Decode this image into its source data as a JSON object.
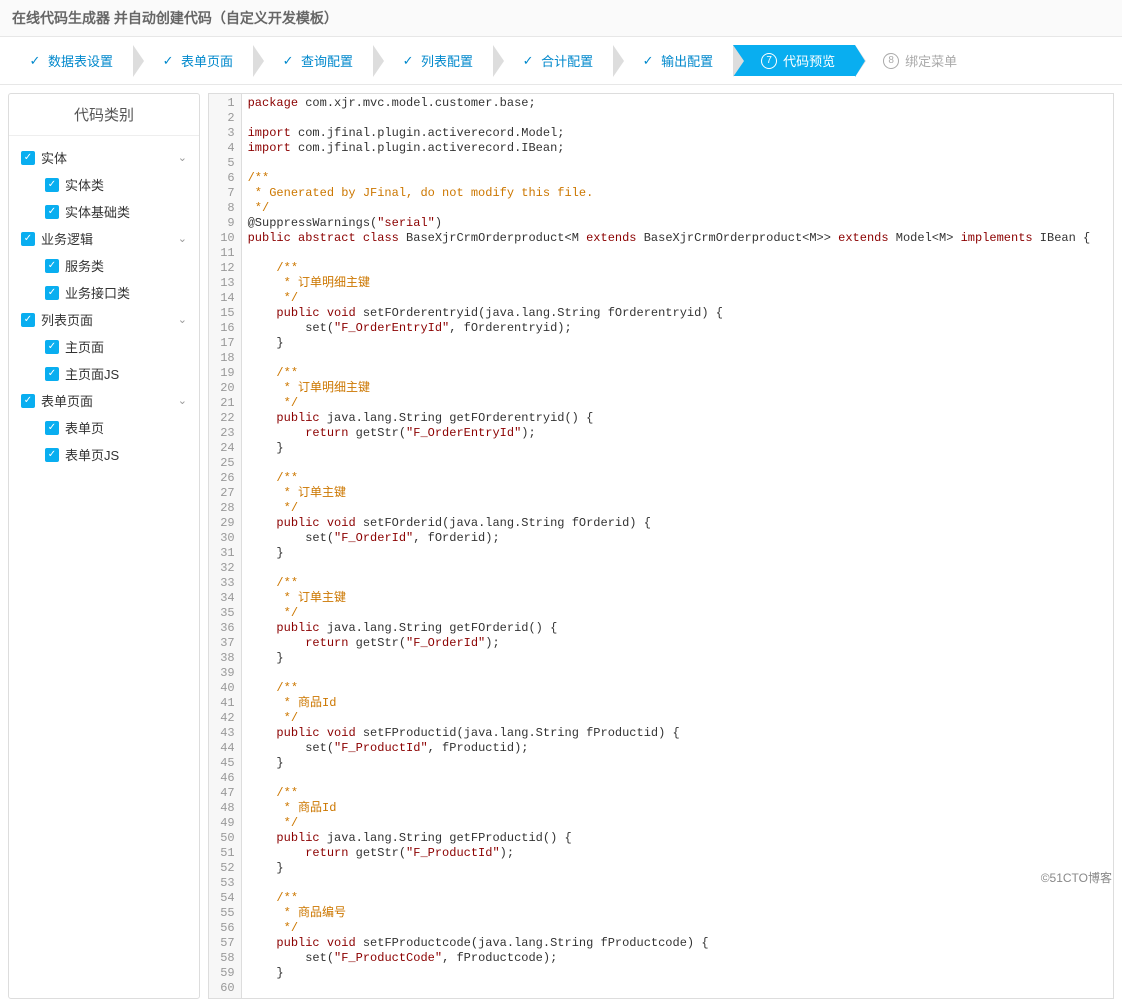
{
  "header": {
    "title": "在线代码生成器 并自动创建代码（自定义开发模板）"
  },
  "steps": [
    {
      "label": "数据表设置",
      "icon": "check",
      "state": "normal"
    },
    {
      "label": "表单页面",
      "icon": "check",
      "state": "normal"
    },
    {
      "label": "查询配置",
      "icon": "check",
      "state": "normal"
    },
    {
      "label": "列表配置",
      "icon": "check",
      "state": "normal"
    },
    {
      "label": "合计配置",
      "icon": "check",
      "state": "normal"
    },
    {
      "label": "输出配置",
      "icon": "check",
      "state": "normal"
    },
    {
      "label": "代码预览",
      "icon": "num7",
      "state": "active"
    },
    {
      "label": "绑定菜单",
      "icon": "num8",
      "state": "disabled"
    }
  ],
  "sidebar": {
    "title": "代码类别",
    "tree": [
      {
        "label": "实体",
        "checked": true,
        "level": 0,
        "expandable": true
      },
      {
        "label": "实体类",
        "checked": true,
        "level": 1
      },
      {
        "label": "实体基础类",
        "checked": true,
        "level": 1
      },
      {
        "label": "业务逻辑",
        "checked": true,
        "level": 0,
        "expandable": true
      },
      {
        "label": "服务类",
        "checked": true,
        "level": 1
      },
      {
        "label": "业务接口类",
        "checked": true,
        "level": 1
      },
      {
        "label": "列表页面",
        "checked": true,
        "level": 0,
        "expandable": true
      },
      {
        "label": "主页面",
        "checked": true,
        "level": 1
      },
      {
        "label": "主页面JS",
        "checked": true,
        "level": 1
      },
      {
        "label": "表单页面",
        "checked": true,
        "level": 0,
        "expandable": true
      },
      {
        "label": "表单页",
        "checked": true,
        "level": 1
      },
      {
        "label": "表单页JS",
        "checked": true,
        "level": 1
      }
    ]
  },
  "code": {
    "lines": [
      {
        "t": [
          {
            "c": "",
            "s": ""
          },
          {
            "c": "package",
            "s": "kw"
          },
          {
            "c": " com.xjr.mvc.model.customer.base;",
            "s": ""
          }
        ]
      },
      {
        "t": [
          {
            "c": "",
            "s": ""
          }
        ]
      },
      {
        "t": [
          {
            "c": "import",
            "s": "kw"
          },
          {
            "c": " com.jfinal.plugin.activerecord.Model;",
            "s": ""
          }
        ]
      },
      {
        "t": [
          {
            "c": "import",
            "s": "kw"
          },
          {
            "c": " com.jfinal.plugin.activerecord.IBean;",
            "s": ""
          }
        ]
      },
      {
        "t": [
          {
            "c": "",
            "s": ""
          }
        ]
      },
      {
        "t": [
          {
            "c": "/**",
            "s": "cmt"
          }
        ]
      },
      {
        "t": [
          {
            "c": " * Generated by JFinal, do not modify this file.",
            "s": "cmt"
          }
        ]
      },
      {
        "t": [
          {
            "c": " */",
            "s": "cmt"
          }
        ]
      },
      {
        "t": [
          {
            "c": "@SuppressWarnings(",
            "s": ""
          },
          {
            "c": "\"serial\"",
            "s": "str"
          },
          {
            "c": ")",
            "s": ""
          }
        ]
      },
      {
        "t": [
          {
            "c": "public",
            "s": "kw"
          },
          {
            "c": " ",
            "s": ""
          },
          {
            "c": "abstract",
            "s": "kw"
          },
          {
            "c": " ",
            "s": ""
          },
          {
            "c": "class",
            "s": "kw"
          },
          {
            "c": " BaseXjrCrmOrderproduct<M ",
            "s": ""
          },
          {
            "c": "extends",
            "s": "kw"
          },
          {
            "c": " BaseXjrCrmOrderproduct<M>> ",
            "s": ""
          },
          {
            "c": "extends",
            "s": "kw"
          },
          {
            "c": " Model<M> ",
            "s": ""
          },
          {
            "c": "implements",
            "s": "kw"
          },
          {
            "c": " IBean {",
            "s": ""
          }
        ]
      },
      {
        "t": [
          {
            "c": "",
            "s": ""
          }
        ]
      },
      {
        "t": [
          {
            "c": "    /**",
            "s": "cmt"
          }
        ]
      },
      {
        "t": [
          {
            "c": "     * 订单明细主键",
            "s": "cmt"
          }
        ]
      },
      {
        "t": [
          {
            "c": "     */",
            "s": "cmt"
          }
        ]
      },
      {
        "t": [
          {
            "c": "    ",
            "s": ""
          },
          {
            "c": "public",
            "s": "kw"
          },
          {
            "c": " ",
            "s": ""
          },
          {
            "c": "void",
            "s": "kw"
          },
          {
            "c": " setFOrderentryid(java.lang.String fOrderentryid) {",
            "s": ""
          }
        ]
      },
      {
        "t": [
          {
            "c": "        set(",
            "s": ""
          },
          {
            "c": "\"F_OrderEntryId\"",
            "s": "str"
          },
          {
            "c": ", fOrderentryid);",
            "s": ""
          }
        ]
      },
      {
        "t": [
          {
            "c": "    }",
            "s": ""
          }
        ]
      },
      {
        "t": [
          {
            "c": "",
            "s": ""
          }
        ]
      },
      {
        "t": [
          {
            "c": "    /**",
            "s": "cmt"
          }
        ]
      },
      {
        "t": [
          {
            "c": "     * 订单明细主键",
            "s": "cmt"
          }
        ]
      },
      {
        "t": [
          {
            "c": "     */",
            "s": "cmt"
          }
        ]
      },
      {
        "t": [
          {
            "c": "    ",
            "s": ""
          },
          {
            "c": "public",
            "s": "kw"
          },
          {
            "c": " java.lang.String getFOrderentryid() {",
            "s": ""
          }
        ]
      },
      {
        "t": [
          {
            "c": "        ",
            "s": ""
          },
          {
            "c": "return",
            "s": "kw"
          },
          {
            "c": " getStr(",
            "s": ""
          },
          {
            "c": "\"F_OrderEntryId\"",
            "s": "str"
          },
          {
            "c": ");",
            "s": ""
          }
        ]
      },
      {
        "t": [
          {
            "c": "    }",
            "s": ""
          }
        ]
      },
      {
        "t": [
          {
            "c": "",
            "s": ""
          }
        ]
      },
      {
        "t": [
          {
            "c": "    /**",
            "s": "cmt"
          }
        ]
      },
      {
        "t": [
          {
            "c": "     * 订单主键",
            "s": "cmt"
          }
        ]
      },
      {
        "t": [
          {
            "c": "     */",
            "s": "cmt"
          }
        ]
      },
      {
        "t": [
          {
            "c": "    ",
            "s": ""
          },
          {
            "c": "public",
            "s": "kw"
          },
          {
            "c": " ",
            "s": ""
          },
          {
            "c": "void",
            "s": "kw"
          },
          {
            "c": " setFOrderid(java.lang.String fOrderid) {",
            "s": ""
          }
        ]
      },
      {
        "t": [
          {
            "c": "        set(",
            "s": ""
          },
          {
            "c": "\"F_OrderId\"",
            "s": "str"
          },
          {
            "c": ", fOrderid);",
            "s": ""
          }
        ]
      },
      {
        "t": [
          {
            "c": "    }",
            "s": ""
          }
        ]
      },
      {
        "t": [
          {
            "c": "",
            "s": ""
          }
        ]
      },
      {
        "t": [
          {
            "c": "    /**",
            "s": "cmt"
          }
        ]
      },
      {
        "t": [
          {
            "c": "     * 订单主键",
            "s": "cmt"
          }
        ]
      },
      {
        "t": [
          {
            "c": "     */",
            "s": "cmt"
          }
        ]
      },
      {
        "t": [
          {
            "c": "    ",
            "s": ""
          },
          {
            "c": "public",
            "s": "kw"
          },
          {
            "c": " java.lang.String getFOrderid() {",
            "s": ""
          }
        ]
      },
      {
        "t": [
          {
            "c": "        ",
            "s": ""
          },
          {
            "c": "return",
            "s": "kw"
          },
          {
            "c": " getStr(",
            "s": ""
          },
          {
            "c": "\"F_OrderId\"",
            "s": "str"
          },
          {
            "c": ");",
            "s": ""
          }
        ]
      },
      {
        "t": [
          {
            "c": "    }",
            "s": ""
          }
        ]
      },
      {
        "t": [
          {
            "c": "",
            "s": ""
          }
        ]
      },
      {
        "t": [
          {
            "c": "    /**",
            "s": "cmt"
          }
        ]
      },
      {
        "t": [
          {
            "c": "     * 商品Id",
            "s": "cmt"
          }
        ]
      },
      {
        "t": [
          {
            "c": "     */",
            "s": "cmt"
          }
        ]
      },
      {
        "t": [
          {
            "c": "    ",
            "s": ""
          },
          {
            "c": "public",
            "s": "kw"
          },
          {
            "c": " ",
            "s": ""
          },
          {
            "c": "void",
            "s": "kw"
          },
          {
            "c": " setFProductid(java.lang.String fProductid) {",
            "s": ""
          }
        ]
      },
      {
        "t": [
          {
            "c": "        set(",
            "s": ""
          },
          {
            "c": "\"F_ProductId\"",
            "s": "str"
          },
          {
            "c": ", fProductid);",
            "s": ""
          }
        ]
      },
      {
        "t": [
          {
            "c": "    }",
            "s": ""
          }
        ]
      },
      {
        "t": [
          {
            "c": "",
            "s": ""
          }
        ]
      },
      {
        "t": [
          {
            "c": "    /**",
            "s": "cmt"
          }
        ]
      },
      {
        "t": [
          {
            "c": "     * 商品Id",
            "s": "cmt"
          }
        ]
      },
      {
        "t": [
          {
            "c": "     */",
            "s": "cmt"
          }
        ]
      },
      {
        "t": [
          {
            "c": "    ",
            "s": ""
          },
          {
            "c": "public",
            "s": "kw"
          },
          {
            "c": " java.lang.String getFProductid() {",
            "s": ""
          }
        ]
      },
      {
        "t": [
          {
            "c": "        ",
            "s": ""
          },
          {
            "c": "return",
            "s": "kw"
          },
          {
            "c": " getStr(",
            "s": ""
          },
          {
            "c": "\"F_ProductId\"",
            "s": "str"
          },
          {
            "c": ");",
            "s": ""
          }
        ]
      },
      {
        "t": [
          {
            "c": "    }",
            "s": ""
          }
        ]
      },
      {
        "t": [
          {
            "c": "",
            "s": ""
          }
        ]
      },
      {
        "t": [
          {
            "c": "    /**",
            "s": "cmt"
          }
        ]
      },
      {
        "t": [
          {
            "c": "     * 商品编号",
            "s": "cmt"
          }
        ]
      },
      {
        "t": [
          {
            "c": "     */",
            "s": "cmt"
          }
        ]
      },
      {
        "t": [
          {
            "c": "    ",
            "s": ""
          },
          {
            "c": "public",
            "s": "kw"
          },
          {
            "c": " ",
            "s": ""
          },
          {
            "c": "void",
            "s": "kw"
          },
          {
            "c": " setFProductcode(java.lang.String fProductcode) {",
            "s": ""
          }
        ]
      },
      {
        "t": [
          {
            "c": "        set(",
            "s": ""
          },
          {
            "c": "\"F_ProductCode\"",
            "s": "str"
          },
          {
            "c": ", fProductcode);",
            "s": ""
          }
        ]
      },
      {
        "t": [
          {
            "c": "    }",
            "s": ""
          }
        ]
      },
      {
        "t": [
          {
            "c": "",
            "s": ""
          }
        ]
      }
    ]
  },
  "watermark": "©51CTO博客"
}
